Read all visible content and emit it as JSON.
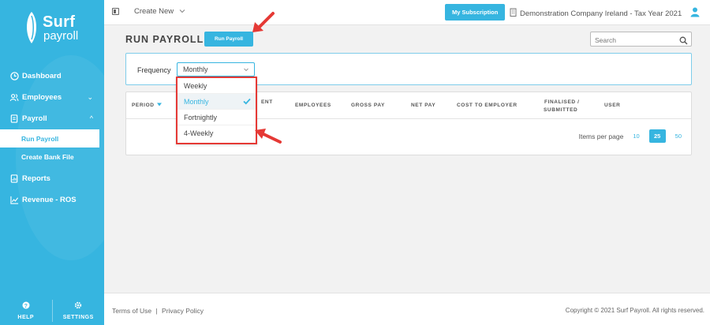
{
  "app": {
    "logo_line1": "Surf",
    "logo_line2": "payroll"
  },
  "colors": {
    "accent": "#36b5e0",
    "highlight_red": "#e53935"
  },
  "sidebar": {
    "items": [
      {
        "label": "Dashboard",
        "icon": "clock-icon"
      },
      {
        "label": "Employees",
        "icon": "users-icon",
        "chevron": "⌄"
      },
      {
        "label": "Payroll",
        "icon": "document-icon",
        "chevron": "^"
      },
      {
        "label": "Reports",
        "icon": "report-icon"
      },
      {
        "label": "Revenue - ROS",
        "icon": "chart-line-icon"
      }
    ],
    "payroll_sub": [
      {
        "label": "Run Payroll",
        "active": true
      },
      {
        "label": "Create Bank File",
        "active": false
      }
    ],
    "help_label": "HELP",
    "settings_label": "SETTINGS"
  },
  "topbar": {
    "create_new": "Create New",
    "subscription_label": "My Subscription",
    "company": "Demonstration Company Ireland - Tax Year 2021"
  },
  "main": {
    "title": "RUN PAYROLL",
    "run_button": "Run Payroll",
    "search_placeholder": "Search",
    "frequency_label": "Frequency",
    "frequency_value": "Monthly",
    "frequency_options": [
      {
        "label": "Weekly",
        "selected": false
      },
      {
        "label": "Monthly",
        "selected": true
      },
      {
        "label": "Fortnightly",
        "selected": false
      },
      {
        "label": "4-Weekly",
        "selected": false
      }
    ],
    "table_headers": {
      "period": "PERIOD",
      "payment_partial": "ENT",
      "employees": "EMPLOYEES",
      "gross_pay": "GROSS PAY",
      "net_pay": "NET PAY",
      "cost_to_employer": "COST TO EMPLOYER",
      "finalised_line1": "FINALISED /",
      "finalised_line2": "SUBMITTED",
      "user": "USER"
    },
    "pager": {
      "label": "Items per page",
      "options": [
        "10",
        "25",
        "50"
      ],
      "active": "25"
    }
  },
  "footer": {
    "terms": "Terms of Use",
    "separator": "|",
    "privacy": "Privacy Policy",
    "copyright": "Copyright © 2021 Surf Payroll. All rights reserved."
  }
}
